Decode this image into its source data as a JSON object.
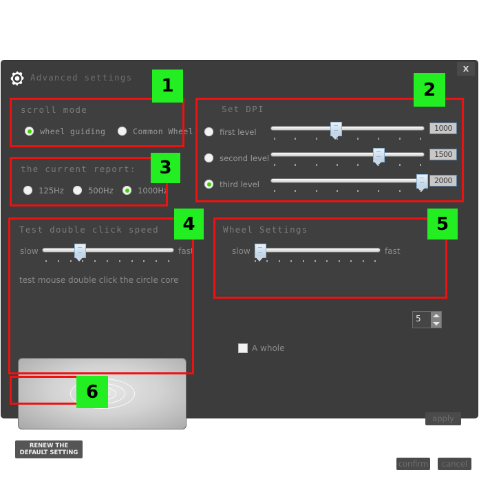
{
  "window": {
    "title": "Advanced settings",
    "gear_icon": "gear-icon",
    "close_label": "X"
  },
  "scroll_mode": {
    "title": "scroll mode",
    "options": [
      {
        "label": "wheel guiding",
        "selected": true
      },
      {
        "label": "Common Wheel",
        "selected": false
      }
    ]
  },
  "report_rate": {
    "title": "the current report:",
    "options": [
      {
        "label": "125Hz",
        "selected": false
      },
      {
        "label": "500Hz",
        "selected": false
      },
      {
        "label": "1000Hz",
        "selected": true
      }
    ]
  },
  "set_dpi": {
    "title": "Set DPI",
    "levels": [
      {
        "label": "first level",
        "selected": false,
        "value": "1000",
        "percent": 42
      },
      {
        "label": "second level",
        "selected": false,
        "value": "1500",
        "percent": 70
      },
      {
        "label": "third level",
        "selected": true,
        "value": "2000",
        "percent": 98
      }
    ],
    "tick_count": 8
  },
  "double_click": {
    "title": "Test double click speed",
    "slow_label": "slow",
    "fast_label": "fast",
    "percent": 28,
    "tick_count": 11,
    "hint": "test mouse double click the circle core"
  },
  "wheel_settings": {
    "title": "Wheel Settings",
    "slow_label": "slow",
    "fast_label": "fast",
    "percent": 3,
    "tick_count": 11,
    "spinner_value": "5",
    "checkbox_label": "A whole",
    "checkbox_checked": false
  },
  "footer": {
    "renew_line1": "RENEW THE",
    "renew_line2": "DEFAULT SETTING",
    "apply": "apply",
    "confirm": "confirm",
    "cancel": "cancel"
  },
  "annotations": {
    "badges": [
      "1",
      "2",
      "3",
      "4",
      "5",
      "6"
    ]
  },
  "colors": {
    "accent_green": "#3fd200",
    "annotation_red": "#ee1111",
    "annotation_green": "#22ee22",
    "dialog_bg": "#3c3c3c",
    "panel_bg": "#3f3f3f"
  }
}
